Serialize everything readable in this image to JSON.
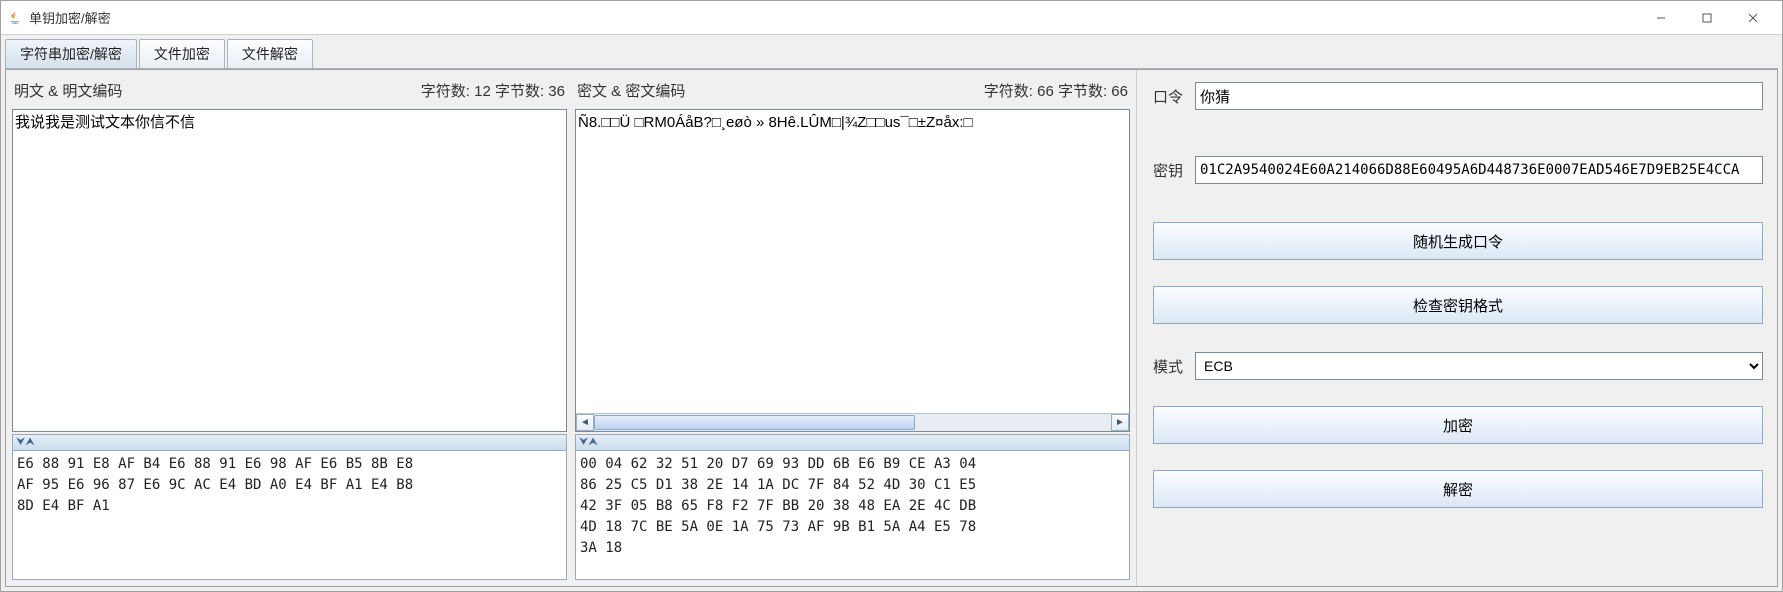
{
  "window": {
    "title": "单钥加密/解密"
  },
  "tabs": {
    "string": "字符串加密/解密",
    "file_enc": "文件加密",
    "file_dec": "文件解密"
  },
  "plain": {
    "head_label": "明文 & 明文编码",
    "count_label": "字符数: 12 字节数: 36",
    "text": "我说我是测试文本你信不信",
    "hex_title": "⮟⮝",
    "hex": "E6 88 91 E8 AF B4 E6 88 91 E6 98 AF E6 B5 8B E8\nAF 95 E6 96 87 E6 9C AC E4 BD A0 E4 BF A1 E4 B8\n8D E4 BF A1"
  },
  "cipher": {
    "head_label": "密文 & 密文编码",
    "count_label": "字符数: 66 字节数: 66",
    "text": "Ñ8.□□Ü □RM0ÁåB?□¸eøò » 8Hê.LÛM□|¾Z□□us¯□±Z¤åx:□",
    "hex_title": "⮟⮝",
    "hex": "00 04 62 32 51 20 D7 69 93 DD 6B E6 B9 CE A3 04\n86 25 C5 D1 38 2E 14 1A DC 7F 84 52 4D 30 C1 E5\n42 3F 05 B8 65 F8 F2 7F BB 20 38 48 EA 2E 4C DB\n4D 18 7C BE 5A 0E 1A 75 73 AF 9B B1 5A A4 E5 78\n3A 18"
  },
  "right": {
    "password_label": "口令",
    "password_value": "你猜",
    "key_label": "密钥",
    "key_value": "01C2A9540024E60A214066D88E60495A6D448736E0007EAD546E7D9EB25E4CCA",
    "btn_gen_pwd": "随机生成口令",
    "btn_check_key": "检查密钥格式",
    "mode_label": "模式",
    "mode_value": "ECB",
    "btn_encrypt": "加密",
    "btn_decrypt": "解密"
  },
  "scroll": {
    "thumb_left_pct": 0,
    "thumb_width_pct": 62
  }
}
